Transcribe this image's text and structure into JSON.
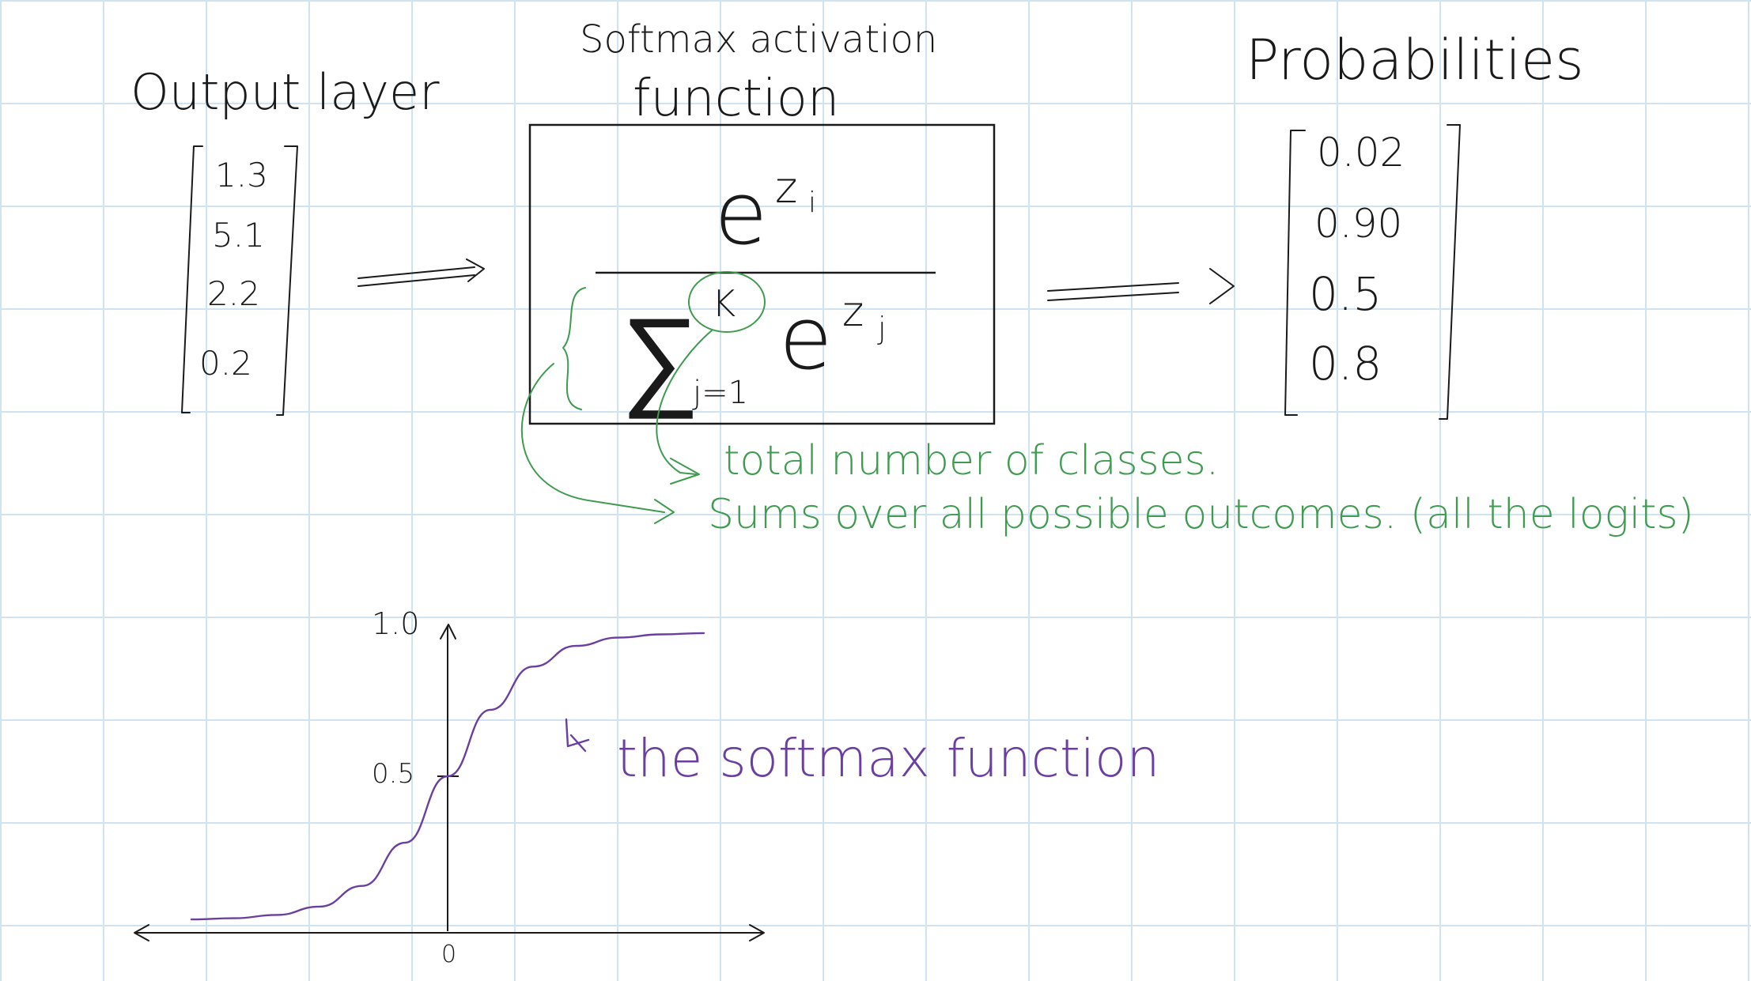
{
  "output_layer": {
    "title": "Output layer",
    "values": [
      "1.3",
      "5.1",
      "2.2",
      "0.2"
    ]
  },
  "softmax": {
    "title_line1": "Softmax activation",
    "title_line2": "function",
    "numerator_base": "e",
    "numerator_exp": "z",
    "numerator_sub": "i",
    "sum_symbol": "∑",
    "sum_upper": "K",
    "sum_lower": "j=1",
    "denominator_base": "e",
    "denominator_exp": "z",
    "denominator_sub": "j"
  },
  "probabilities": {
    "title": "Probabilities",
    "values": [
      "0.02",
      "0.90",
      "0.5",
      "0.8"
    ]
  },
  "annotations": {
    "k_note": "total number of classes.",
    "sum_note": "Sums over all possible outcomes. (all the logits)"
  },
  "chart_data": {
    "type": "line",
    "title": "",
    "xlabel": "",
    "ylabel": "",
    "x_tick_labels": [
      "0"
    ],
    "y_tick_labels": [
      "1.0",
      "0.5"
    ],
    "ylim": [
      0,
      1.0
    ],
    "series": [
      {
        "x": [
          -6,
          -5,
          -4,
          -3,
          -2,
          -1,
          0,
          1,
          2,
          3,
          4,
          5,
          6
        ],
        "y": [
          0.0025,
          0.0067,
          0.018,
          0.047,
          0.119,
          0.269,
          0.5,
          0.731,
          0.881,
          0.953,
          0.982,
          0.993,
          0.9975
        ]
      }
    ],
    "annotation": "the softmax function",
    "colors": {
      "curve": "#6a3fa0",
      "axes": "#1a1a1a"
    }
  },
  "colors": {
    "ink": "#1a1a1a",
    "green": "#3e9b4f",
    "purple": "#6a3fa0",
    "grid": "#cfe3f3"
  }
}
